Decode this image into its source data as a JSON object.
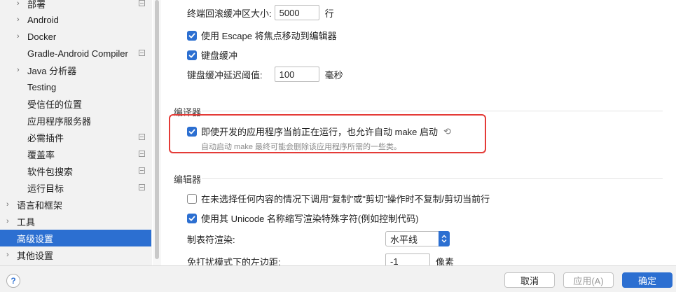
{
  "sidebar": {
    "items": [
      {
        "label": "部署",
        "arrow": true,
        "marker": true
      },
      {
        "label": "Android",
        "arrow": true,
        "marker": false
      },
      {
        "label": "Docker",
        "arrow": true,
        "marker": false
      },
      {
        "label": "Gradle-Android Compiler",
        "arrow": false,
        "marker": true
      },
      {
        "label": "Java 分析器",
        "arrow": true,
        "marker": false
      },
      {
        "label": "Testing",
        "arrow": false,
        "marker": false
      },
      {
        "label": "受信任的位置",
        "arrow": false,
        "marker": false
      },
      {
        "label": "应用程序服务器",
        "arrow": false,
        "marker": false
      },
      {
        "label": "必需插件",
        "arrow": false,
        "marker": true
      },
      {
        "label": "覆盖率",
        "arrow": false,
        "marker": true
      },
      {
        "label": "软件包搜索",
        "arrow": false,
        "marker": true
      },
      {
        "label": "运行目标",
        "arrow": false,
        "marker": true
      },
      {
        "label": "语言和框架",
        "arrow": true,
        "marker": false
      },
      {
        "label": "工具",
        "arrow": true,
        "marker": false
      },
      {
        "label": "高级设置",
        "arrow": false,
        "marker": false,
        "selected": true
      },
      {
        "label": "其他设置",
        "arrow": true,
        "marker": false
      }
    ]
  },
  "terminal": {
    "scroll_buffer_label": "终端回滚缓冲区大小:",
    "scroll_buffer_value": "5000",
    "scroll_buffer_unit": "行",
    "escape_focus_label": "使用 Escape 将焦点移动到编辑器",
    "keyboard_buffer_label": "键盘缓冲",
    "keyboard_delay_label": "键盘缓冲延迟阈值:",
    "keyboard_delay_value": "100",
    "keyboard_delay_unit": "毫秒"
  },
  "compiler": {
    "section_title": "编译器",
    "auto_make_label": "即使开发的应用程序当前正在运行，也允许自动 make 启动",
    "auto_make_hint": "自动启动 make 最终可能会删除该应用程序所需的一些类。"
  },
  "editor": {
    "section_title": "编辑器",
    "copy_cut_label": "在未选择任何内容的情况下调用\"复制\"或\"剪切\"操作时不复制/剪切当前行",
    "unicode_label": "使用其 Unicode 名称缩写渲染特殊字符(例如控制代码)",
    "tab_render_label": "制表符渲染:",
    "tab_render_value": "水平线",
    "distraction_label": "免打扰模式下的左边距:",
    "distraction_value": "-1",
    "distraction_unit": "像素"
  },
  "footer": {
    "help": "?",
    "cancel": "取消",
    "apply": "应用(A)",
    "ok": "确定"
  },
  "colors": {
    "accent": "#2c6fd1",
    "highlight": "#e43b37"
  }
}
